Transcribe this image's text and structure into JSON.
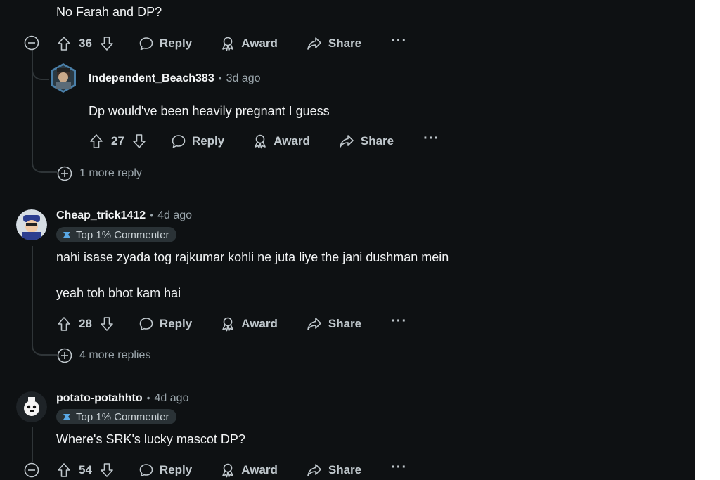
{
  "comments": [
    {
      "body": "No Farah and DP?",
      "votes": "36",
      "reply_label": "Reply",
      "award_label": "Award",
      "share_label": "Share",
      "more_label": "···",
      "replies": [
        {
          "author": "Independent_Beach383",
          "age": "3d ago",
          "body": "Dp would've been heavily pregnant I guess",
          "votes": "27",
          "reply_label": "Reply",
          "award_label": "Award",
          "share_label": "Share",
          "more_label": "···"
        }
      ],
      "more_replies": "1 more reply"
    },
    {
      "author": "Cheap_trick1412",
      "age": "4d ago",
      "flair": "Top 1% Commenter",
      "body_lines": [
        "nahi isase zyada tog rajkumar kohli ne juta liye the jani dushman mein",
        "yeah toh bhot kam hai"
      ],
      "votes": "28",
      "reply_label": "Reply",
      "award_label": "Award",
      "share_label": "Share",
      "more_label": "···",
      "more_replies": "4 more replies"
    },
    {
      "author": "potato-potahhto",
      "age": "4d ago",
      "flair": "Top 1% Commenter",
      "body": "Where's SRK's lucky mascot DP?",
      "votes": "54",
      "reply_label": "Reply",
      "award_label": "Award",
      "share_label": "Share",
      "more_label": "···"
    }
  ],
  "separator": "•",
  "icons": [
    "upvote-icon",
    "downvote-icon",
    "reply-icon",
    "award-icon",
    "share-icon",
    "collapse-icon",
    "expand-icon",
    "flair-icon"
  ],
  "colors": {
    "background": "#0e1113",
    "text": "#f2f4f5",
    "muted": "#9ba6ac",
    "flair_bg": "#2a3236",
    "flair_icon": "#5aa9e6"
  }
}
